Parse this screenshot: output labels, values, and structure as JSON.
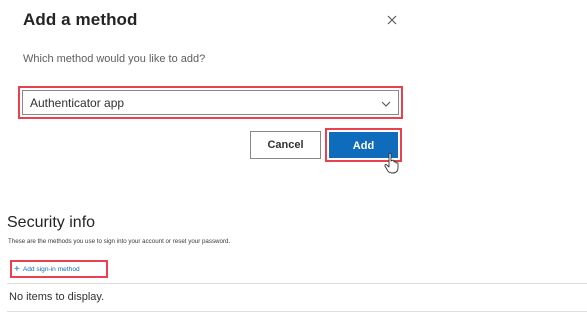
{
  "dialog": {
    "title": "Add a method",
    "close_icon": "close-icon",
    "prompt": "Which method would you like to add?",
    "method_select": {
      "selected": "Authenticator app",
      "icon": "chevron-down-icon"
    },
    "cancel_label": "Cancel",
    "add_label": "Add"
  },
  "security_info": {
    "title": "Security info",
    "description": "These are the methods you use to sign into your account or reset your password.",
    "add_method_label": "Add sign-in method",
    "add_method_icon": "plus-icon",
    "empty_text": "No items to display."
  },
  "colors": {
    "accent": "#0f6cbd",
    "highlight_border": "#e8414f",
    "text": "#252423",
    "muted_text": "#605e5c"
  }
}
